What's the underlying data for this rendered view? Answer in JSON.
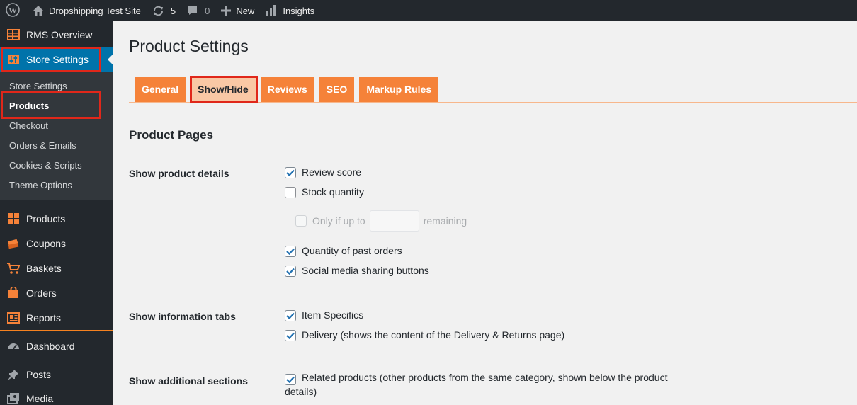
{
  "adminbar": {
    "site_name": "Dropshipping Test Site",
    "updates_count": "5",
    "comments_count": "0",
    "new_label": "New",
    "insights_label": "Insights"
  },
  "sidebar": {
    "rms_overview": "RMS Overview",
    "store_settings": "Store Settings",
    "submenu": [
      "Store Settings",
      "Products",
      "Checkout",
      "Orders & Emails",
      "Cookies & Scripts",
      "Theme Options"
    ],
    "products": "Products",
    "coupons": "Coupons",
    "baskets": "Baskets",
    "orders": "Orders",
    "reports": "Reports",
    "dashboard": "Dashboard",
    "posts": "Posts",
    "media": "Media"
  },
  "page": {
    "title": "Product Settings",
    "tabs": [
      "General",
      "Show/Hide",
      "Reviews",
      "SEO",
      "Markup Rules"
    ],
    "section_title": "Product Pages",
    "labels": {
      "details": "Show product details",
      "tabs": "Show information tabs",
      "additional": "Show additional sections"
    },
    "options": {
      "review_score": "Review score",
      "stock_quantity": "Stock quantity",
      "only_if_up_to": "Only if up to",
      "remaining": "remaining",
      "stock_threshold_value": "",
      "past_orders": "Quantity of past orders",
      "social_sharing": "Social media sharing buttons",
      "item_specifics": "Item Specifics",
      "delivery": "Delivery (shows the content of the Delivery & Returns page)",
      "related_products": "Related products (other products from the same category, shown below the product details)"
    }
  },
  "colors": {
    "accent_orange": "#f58239",
    "highlight_red": "#e0271a",
    "wp_blue": "#0073aa",
    "check_blue": "#2271b1"
  }
}
